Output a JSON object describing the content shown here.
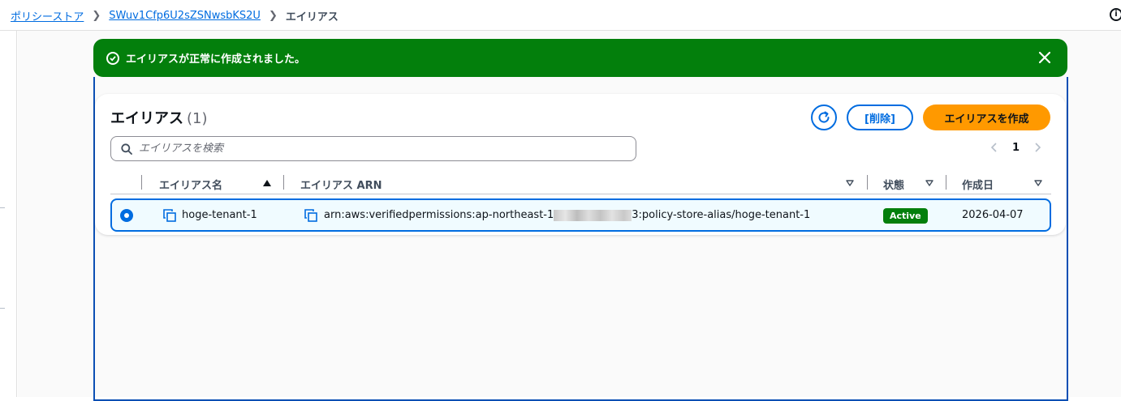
{
  "breadcrumb": {
    "items": [
      {
        "label": "ポリシーストア"
      },
      {
        "label": "SWuv1Cfp6U2sZSNwsbKS2U"
      }
    ],
    "current": "エイリアス"
  },
  "flash": {
    "message": "エイリアスが正常に作成されました。",
    "status_color": "#037f0c"
  },
  "container": {
    "title": "エイリアス",
    "count": "(1)",
    "delete_label": "[削除]",
    "create_label": "エイリアスを作成",
    "accent_color": "#ff9900"
  },
  "search": {
    "placeholder": "エイリアスを検索",
    "value": ""
  },
  "pagination": {
    "current_page": "1"
  },
  "table": {
    "columns": [
      {
        "label": "エイリアス名"
      },
      {
        "label": "エイリアス ARN"
      },
      {
        "label": "状態"
      },
      {
        "label": "作成日"
      }
    ],
    "rows": [
      {
        "name": "hoge-tenant-1",
        "arn_prefix": "arn:aws:verifiedpermissions:ap-northeast-1",
        "arn_suffix": "3:policy-store-alias/hoge-tenant-1",
        "status": "Active",
        "created": "2026-04-07"
      }
    ]
  }
}
